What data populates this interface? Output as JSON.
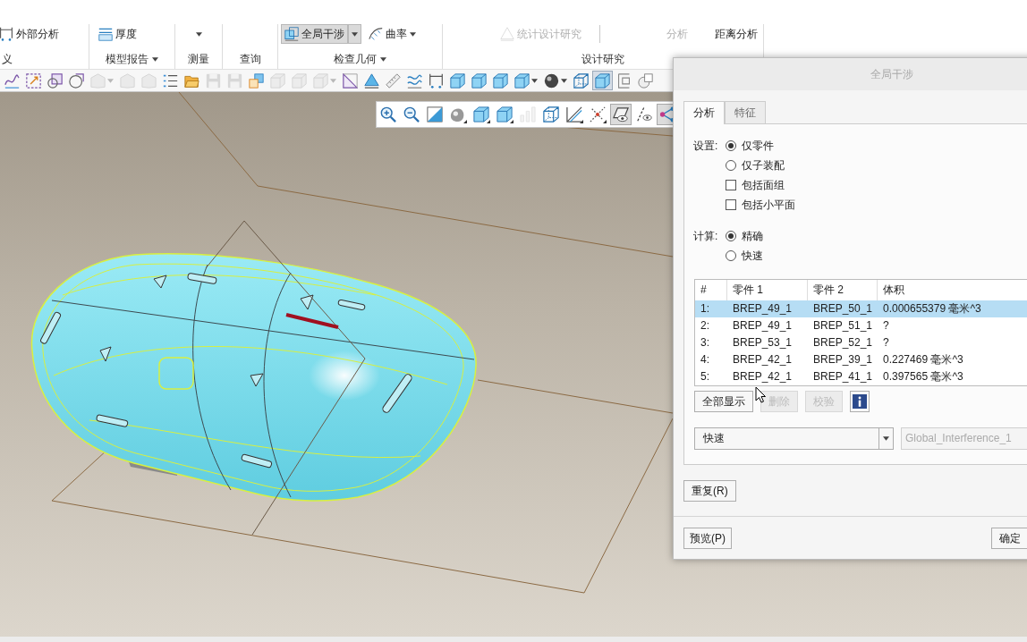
{
  "ribbon": {
    "groups": [
      {
        "label": "义",
        "menu": false,
        "sections": [
          [
            {
              "kind": "tool",
              "label": "外部分析",
              "selected": false,
              "disabled": false
            }
          ]
        ]
      },
      {
        "label": "模型报告",
        "menu": true,
        "sections": [
          [
            {
              "kind": "tool",
              "label": "厚度",
              "selected": false,
              "disabled": false
            }
          ]
        ]
      },
      {
        "label": "测量",
        "menu": false,
        "sections": [
          [
            {
              "kind": "caret",
              "selected": false,
              "disabled": false
            }
          ]
        ]
      },
      {
        "label": "查询",
        "menu": false
      },
      {
        "label": "检查几何",
        "menu": true,
        "sections": [
          [
            {
              "kind": "split",
              "label": "全局干涉",
              "selected": true,
              "disabled": false
            },
            {
              "kind": "menu",
              "label": "曲率",
              "selected": false,
              "disabled": false
            }
          ]
        ]
      },
      {
        "label": "设计研究",
        "menu": false,
        "sections": [
          [
            {
              "kind": "tool",
              "label": "统计设计研究",
              "selected": false,
              "disabled": true
            }
          ],
          [
            {
              "kind": "text",
              "label": "分析",
              "selected": false,
              "disabled": true
            },
            {
              "kind": "text",
              "label": "距离分析",
              "selected": false,
              "disabled": false
            }
          ]
        ]
      }
    ]
  },
  "toolbar": {
    "buttons": [
      {
        "menu": false,
        "on": false,
        "disabled": false
      },
      {
        "menu": false,
        "on": false,
        "disabled": false
      },
      {
        "menu": false,
        "on": false,
        "disabled": false
      },
      {
        "menu": false,
        "on": false,
        "disabled": false
      },
      {
        "menu": true,
        "on": false,
        "disabled": true
      },
      {
        "menu": false,
        "on": false,
        "disabled": true
      },
      {
        "menu": false,
        "on": false,
        "disabled": true
      },
      {
        "menu": false,
        "on": false,
        "disabled": false
      },
      {
        "menu": false,
        "on": false,
        "disabled": false
      },
      {
        "menu": false,
        "on": false,
        "disabled": true
      },
      {
        "menu": false,
        "on": false,
        "disabled": true
      },
      {
        "menu": false,
        "on": false,
        "disabled": false
      },
      {
        "menu": false,
        "on": false,
        "disabled": true
      },
      {
        "menu": false,
        "on": false,
        "disabled": true
      },
      {
        "menu": true,
        "on": false,
        "disabled": true
      },
      {
        "menu": false,
        "on": false,
        "disabled": false
      },
      {
        "menu": false,
        "on": false,
        "disabled": false
      },
      {
        "menu": false,
        "on": false,
        "disabled": false
      },
      {
        "menu": false,
        "on": false,
        "disabled": false
      },
      {
        "menu": false,
        "on": false,
        "disabled": false
      },
      {
        "menu": false,
        "on": false,
        "disabled": false
      },
      {
        "menu": false,
        "on": false,
        "disabled": false
      },
      {
        "menu": false,
        "on": false,
        "disabled": false
      },
      {
        "menu": true,
        "on": false,
        "disabled": false
      },
      {
        "menu": true,
        "on": false,
        "disabled": false
      },
      {
        "menu": false,
        "on": false,
        "disabled": false
      },
      {
        "menu": false,
        "on": true,
        "disabled": false
      },
      {
        "menu": false,
        "on": false,
        "disabled": false
      },
      {
        "menu": false,
        "on": false,
        "disabled": false
      }
    ]
  },
  "view_toolbar": {
    "buttons": [
      {
        "menu": false,
        "on": false,
        "disabled": false
      },
      {
        "menu": false,
        "on": false,
        "disabled": false
      },
      {
        "menu": false,
        "on": false,
        "disabled": false
      },
      {
        "menu": true,
        "on": false,
        "disabled": false
      },
      {
        "menu": true,
        "on": false,
        "disabled": false
      },
      {
        "menu": true,
        "on": false,
        "disabled": false
      },
      {
        "menu": false,
        "on": false,
        "disabled": true
      },
      {
        "menu": false,
        "on": false,
        "disabled": false
      },
      {
        "menu": true,
        "on": false,
        "disabled": false
      },
      {
        "menu": true,
        "on": false,
        "disabled": false
      },
      {
        "menu": false,
        "on": true,
        "disabled": false
      },
      {
        "menu": false,
        "on": false,
        "disabled": false
      },
      {
        "menu": false,
        "on": true,
        "disabled": false
      }
    ]
  },
  "dialog": {
    "title": "全局干涉",
    "tabs": [
      {
        "label": "分析",
        "selected": true
      },
      {
        "label": "特征",
        "selected": false
      }
    ],
    "option_groups": [
      {
        "label": "设置:",
        "options": [
          {
            "kind": "radio",
            "label": "仅零件",
            "selected": true
          },
          {
            "kind": "radio",
            "label": "仅子装配",
            "selected": false
          },
          {
            "kind": "checkbox",
            "label": "包括面组",
            "checked": false
          },
          {
            "kind": "checkbox",
            "label": "包括小平面",
            "checked": false
          }
        ]
      },
      {
        "label": "计算:",
        "options": [
          {
            "kind": "radio",
            "label": "精确",
            "selected": true
          },
          {
            "kind": "radio",
            "label": "快速",
            "selected": false
          }
        ]
      }
    ],
    "table": {
      "columns": [
        "#",
        "零件 1",
        "零件 2",
        "体积"
      ],
      "rows": [
        {
          "cells": [
            "1:",
            "BREP_49_1",
            "BREP_50_1",
            "0.000655379 毫米^3"
          ],
          "selected": true
        },
        {
          "cells": [
            "2:",
            "BREP_49_1",
            "BREP_51_1",
            "?"
          ],
          "selected": false
        },
        {
          "cells": [
            "3:",
            "BREP_53_1",
            "BREP_52_1",
            "?"
          ],
          "selected": false
        },
        {
          "cells": [
            "4:",
            "BREP_42_1",
            "BREP_39_1",
            "0.227469 毫米^3"
          ],
          "selected": false
        },
        {
          "cells": [
            "5:",
            "BREP_42_1",
            "BREP_41_1",
            "0.397565 毫米^3"
          ],
          "selected": false
        }
      ]
    },
    "table_buttons": [
      {
        "kind": "text",
        "label": "全部显示",
        "disabled": false
      },
      {
        "kind": "text",
        "label": "删除",
        "disabled": true
      },
      {
        "kind": "text",
        "label": "校验",
        "disabled": true
      },
      {
        "kind": "info",
        "disabled": false
      }
    ],
    "dropdown": {
      "value": "快速"
    },
    "name_field": {
      "value": "Global_Interference_1",
      "disabled": true
    },
    "repeat_button": {
      "label": "重复(R)"
    },
    "footer_buttons": [
      {
        "label": "预览(P)"
      },
      {
        "label": "确定"
      }
    ]
  }
}
